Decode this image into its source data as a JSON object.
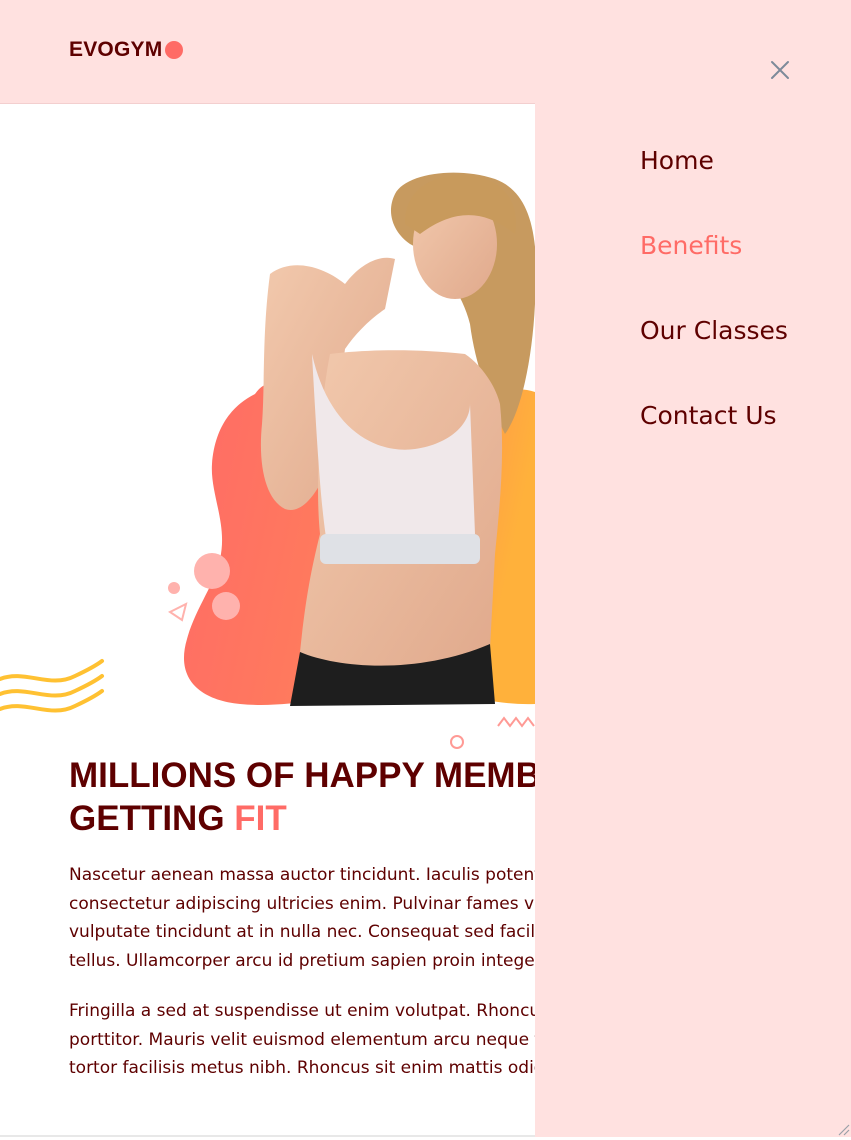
{
  "brand": {
    "logo_text": "EVOGYM"
  },
  "hero": {
    "heading_line1": "MILLIONS OF HAPPY MEMBERS",
    "heading_line2_prefix": "GETTING ",
    "heading_line2_accent": "FIT",
    "paragraph1_lines": [
      "Nascetur aenean massa auctor tincidunt. Iaculis potenti",
      "consectetur adipiscing ultricies enim. Pulvinar fames vitae",
      "vulputate tincidunt at in nulla nec. Consequat sed facilisis dui",
      "tellus. Ullamcorper arcu id pretium sapien proin integer nisl."
    ],
    "paragraph2_lines": [
      "Fringilla a sed at suspendisse ut enim volutpat. Rhoncus vel est",
      "porttitor. Mauris velit euismod elementum arcu neque facilisi.",
      "tortor facilisis metus nibh. Rhoncus sit enim mattis odio."
    ]
  },
  "menu": {
    "items": [
      {
        "label": "Home",
        "active": false
      },
      {
        "label": "Benefits",
        "active": true
      },
      {
        "label": "Our Classes",
        "active": false
      },
      {
        "label": "Contact Us",
        "active": false
      }
    ]
  },
  "colors": {
    "brand_dark": "#5e0000",
    "accent": "#ff6b66",
    "drawer_bg": "#ffe1e0",
    "secondary": "#ffc132"
  },
  "icons": {
    "close": "close-icon"
  }
}
